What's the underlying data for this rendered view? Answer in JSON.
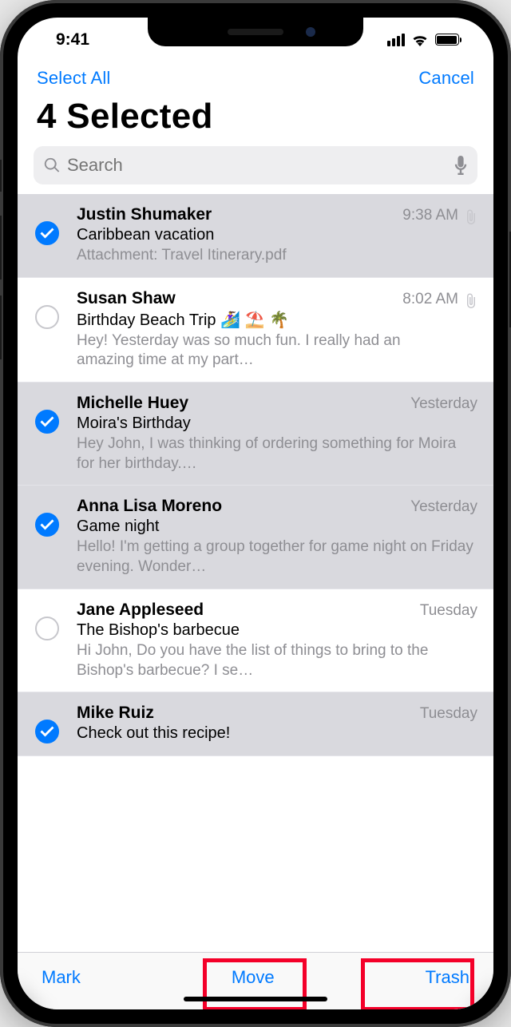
{
  "status": {
    "time": "9:41"
  },
  "nav": {
    "select_all": "Select All",
    "cancel": "Cancel"
  },
  "title": "4 Selected",
  "search": {
    "placeholder": "Search"
  },
  "emails": [
    {
      "sender": "Justin Shumaker",
      "time": "9:38 AM",
      "subject": "Caribbean vacation",
      "preview": "Attachment: Travel Itinerary.pdf",
      "selected": true,
      "attachment": true
    },
    {
      "sender": "Susan Shaw",
      "time": "8:02 AM",
      "subject": "Birthday Beach Trip 🏄‍♀️ ⛱️ 🌴",
      "preview": "Hey! Yesterday was so much fun. I really had an amazing time at my part…",
      "selected": false,
      "attachment": true
    },
    {
      "sender": "Michelle Huey",
      "time": "Yesterday",
      "subject": "Moira's Birthday",
      "preview": "Hey John, I was thinking of ordering something for Moira for her birthday.…",
      "selected": true,
      "attachment": false
    },
    {
      "sender": "Anna Lisa Moreno",
      "time": "Yesterday",
      "subject": "Game night",
      "preview": "Hello! I'm getting a group together for game night on Friday evening. Wonder…",
      "selected": true,
      "attachment": false
    },
    {
      "sender": "Jane Appleseed",
      "time": "Tuesday",
      "subject": "The Bishop's barbecue",
      "preview": "Hi John, Do you have the list of things to bring to the Bishop's barbecue? I se…",
      "selected": false,
      "attachment": false
    },
    {
      "sender": "Mike Ruiz",
      "time": "Tuesday",
      "subject": "Check out this recipe!",
      "preview": "",
      "selected": true,
      "attachment": false
    }
  ],
  "toolbar": {
    "mark": "Mark",
    "move": "Move",
    "trash": "Trash"
  }
}
